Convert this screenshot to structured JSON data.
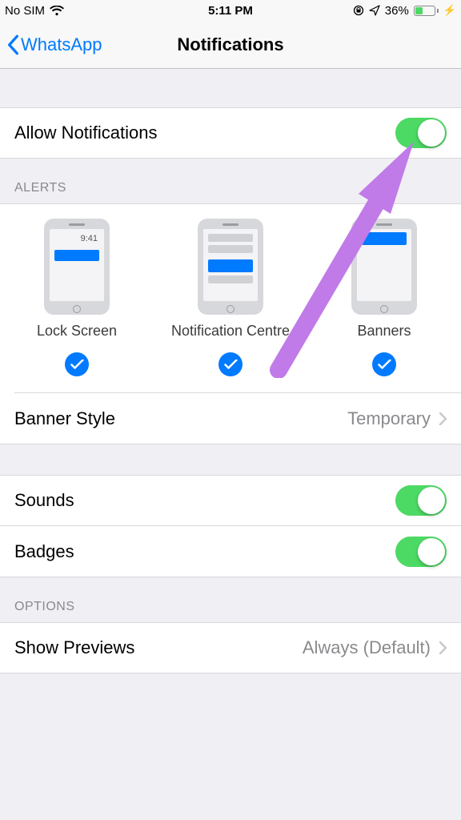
{
  "status": {
    "carrier": "No SIM",
    "time": "5:11 PM",
    "battery_pct": "36%"
  },
  "nav": {
    "back_label": "WhatsApp",
    "title": "Notifications"
  },
  "rows": {
    "allow_label": "Allow Notifications",
    "banner_style_label": "Banner Style",
    "banner_style_value": "Temporary",
    "sounds_label": "Sounds",
    "badges_label": "Badges",
    "show_previews_label": "Show Previews",
    "show_previews_value": "Always (Default)"
  },
  "sections": {
    "alerts": "ALERTS",
    "options": "OPTIONS"
  },
  "alerts": {
    "lock_screen": "Lock Screen",
    "notif_centre": "Notification Centre",
    "banners": "Banners",
    "sample_time": "9:41"
  }
}
